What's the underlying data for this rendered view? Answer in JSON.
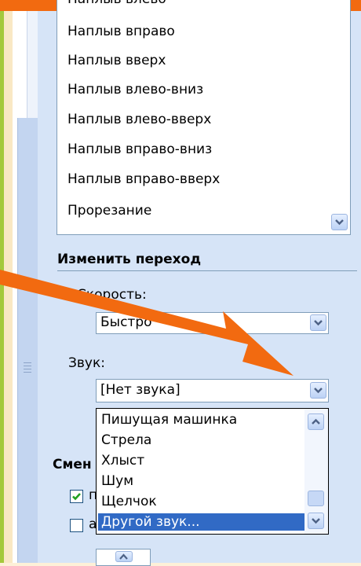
{
  "effects_list": {
    "items": [
      "Наплыв влево",
      "Наплыв вправо",
      "Наплыв вверх",
      "Наплыв влево-вниз",
      "Наплыв влево-вверх",
      "Наплыв вправо-вниз",
      "Наплыв вправо-вверх",
      "Прорезание"
    ]
  },
  "modify_transition": {
    "title": "Изменить переход",
    "speed_label": "Скорость:",
    "speed_value": "Быстро",
    "sound_label": "Звук:",
    "sound_value": "[Нет звука]",
    "sound_options": [
      "Пишущая машинка",
      "Стрела",
      "Хлыст",
      "Шум",
      "Щелчок",
      "Другой звук..."
    ],
    "selected_option": "Другой звук..."
  },
  "advance_slide": {
    "title": "Смен",
    "checkbox1_checked": true,
    "checkbox1_label": "п",
    "checkbox2_checked": false,
    "checkbox2_label": "а"
  },
  "colors": {
    "accent": "#f26a10",
    "selection": "#316ac5",
    "task_pane": "#d6e4f7"
  }
}
